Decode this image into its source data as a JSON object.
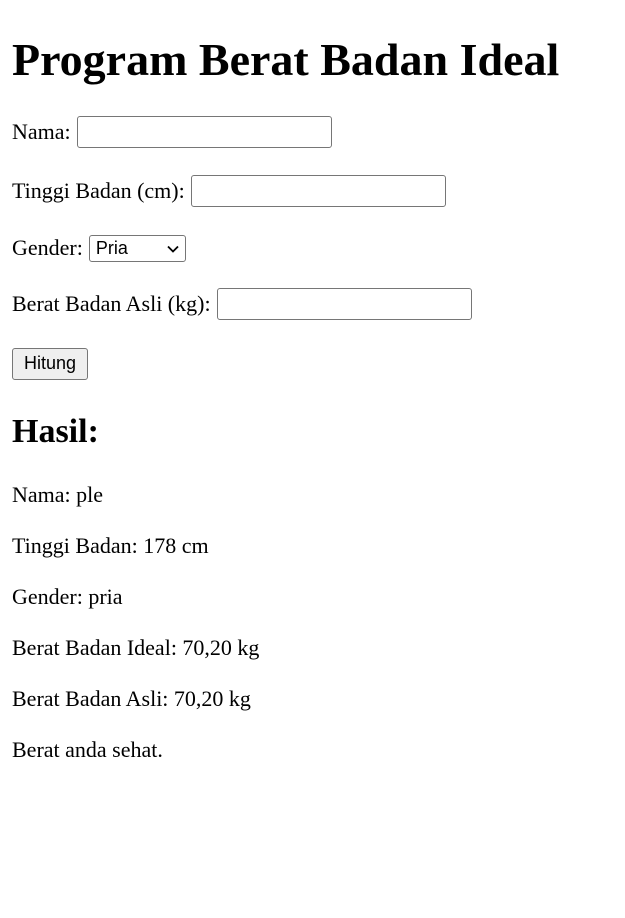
{
  "title": "Program Berat Badan Ideal",
  "form": {
    "name_label": "Nama:",
    "name_value": "",
    "height_label": "Tinggi Badan (cm):",
    "height_value": "",
    "gender_label": "Gender:",
    "gender_selected": "Pria",
    "weight_label": "Berat Badan Asli (kg):",
    "weight_value": "",
    "submit_label": "Hitung"
  },
  "result": {
    "heading": "Hasil:",
    "lines": [
      "Nama: ple",
      "Tinggi Badan: 178 cm",
      "Gender: pria",
      "Berat Badan Ideal: 70,20 kg",
      "Berat Badan Asli: 70,20 kg",
      "Berat anda sehat."
    ]
  },
  "icons": {
    "select_arrow": "chevron-down-icon"
  }
}
